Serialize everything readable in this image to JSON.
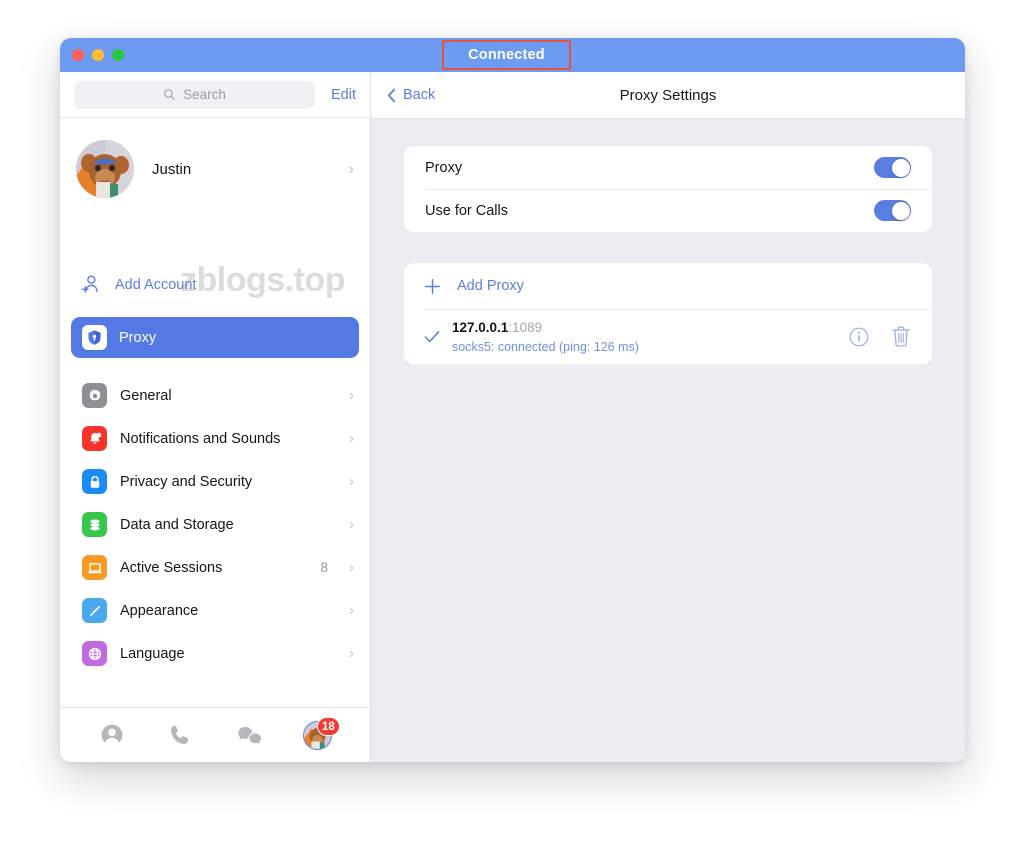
{
  "window": {
    "titlebar": {
      "status_label": "Connected",
      "traffic_lights": [
        "close",
        "minimize",
        "zoom"
      ]
    }
  },
  "sidebar": {
    "search": {
      "placeholder": "Search",
      "icon": "search-icon"
    },
    "edit_label": "Edit",
    "profile": {
      "name": "Justin",
      "chevron": "›"
    },
    "watermark": "zblogs.top",
    "add_account_label": "Add Account",
    "selected": {
      "label": "Proxy",
      "icon": "shield-icon",
      "color": "#5478e4"
    },
    "items": [
      {
        "label": "General",
        "icon": "gear-icon",
        "color": "#8e8e93",
        "count": "",
        "chevron": "›"
      },
      {
        "label": "Notifications and Sounds",
        "icon": "bell-icon",
        "color": "#f5342b",
        "count": "",
        "chevron": "›"
      },
      {
        "label": "Privacy and Security",
        "icon": "lock-icon",
        "color": "#1b8cf3",
        "count": "",
        "chevron": "›"
      },
      {
        "label": "Data and Storage",
        "icon": "database-icon",
        "color": "#37c84b",
        "count": "",
        "chevron": "›"
      },
      {
        "label": "Active Sessions",
        "icon": "laptop-icon",
        "color": "#f59a23",
        "count": "8",
        "chevron": "›"
      },
      {
        "label": "Appearance",
        "icon": "paintbrush-icon",
        "color": "#4aa8ef",
        "count": "",
        "chevron": "›"
      },
      {
        "label": "Language",
        "icon": "globe-icon",
        "color": "#c06ae0",
        "count": "",
        "chevron": "›"
      }
    ],
    "tabs": [
      {
        "name": "contacts",
        "icon": "person-icon"
      },
      {
        "name": "calls",
        "icon": "phone-icon"
      },
      {
        "name": "chats",
        "icon": "chat-bubbles-icon"
      },
      {
        "name": "settings",
        "icon": "avatar-icon",
        "badge": "18"
      }
    ]
  },
  "main": {
    "back_label": "Back",
    "title": "Proxy Settings",
    "settings_card": [
      {
        "label": "Proxy",
        "toggle": "on"
      },
      {
        "label": "Use for Calls",
        "toggle": "on"
      }
    ],
    "proxy_card": {
      "add_label": "Add Proxy",
      "entries": [
        {
          "selected": true,
          "host": "127.0.0.1",
          "port": ":1089",
          "status": "socks5: connected (ping: 126 ms)",
          "info_icon": "info-icon",
          "delete_icon": "trash-icon"
        }
      ]
    }
  },
  "colors": {
    "titlebar_blue": "#6d9bf2",
    "accent_blue": "#5a7ee0",
    "selected_blue": "#5478e4",
    "annotation_red": "#e8503a",
    "content_bg": "#edecf1"
  }
}
